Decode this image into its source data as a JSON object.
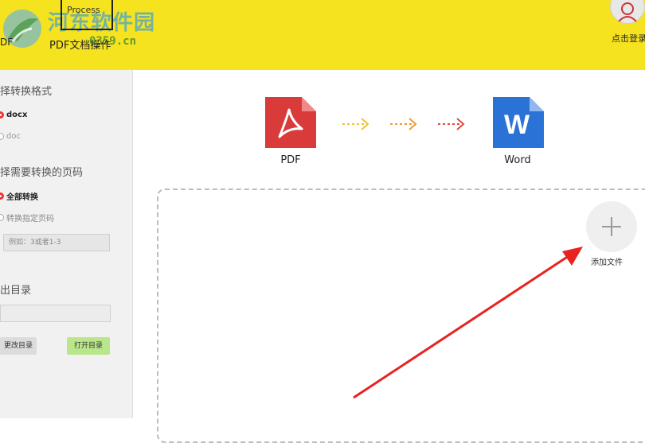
{
  "header": {
    "watermark_title": "河东软件园",
    "watermark_url": "0359.cn",
    "nav_pdf_label": "DF",
    "nav_doc_inner_text": "Process",
    "nav_doc_label": "PDF文档操作",
    "login_label": "点击登录"
  },
  "sidebar": {
    "format_title": "择转换格式",
    "format_options": [
      {
        "label": "docx",
        "selected": true
      },
      {
        "label": "doc",
        "selected": false
      }
    ],
    "pages_title": "择需要转换的页码",
    "page_options": [
      {
        "label": "全部转换",
        "selected": true
      },
      {
        "label": "转换指定页码",
        "selected": false
      }
    ],
    "page_input_placeholder": "例如：3或者1-3",
    "output_title": "出目录",
    "change_dir_button": "更改目录",
    "open_dir_button": "打开目录"
  },
  "main": {
    "source_label": "PDF",
    "target_label": "Word",
    "target_icon_letter": "W",
    "add_file_label": "添加文件"
  },
  "colors": {
    "topbar": "#f6e31f",
    "pdf_red": "#d93b3b",
    "word_blue": "#2a72d6",
    "arrow1": "#f2c12e",
    "arrow2": "#ef9a35",
    "arrow3": "#e4493c",
    "annotation_red": "#e8231f",
    "open_button": "#b9e68a"
  },
  "icons": {
    "pdf": "pdf-file-icon",
    "word": "word-file-icon",
    "add": "plus-icon",
    "user": "user-icon"
  }
}
